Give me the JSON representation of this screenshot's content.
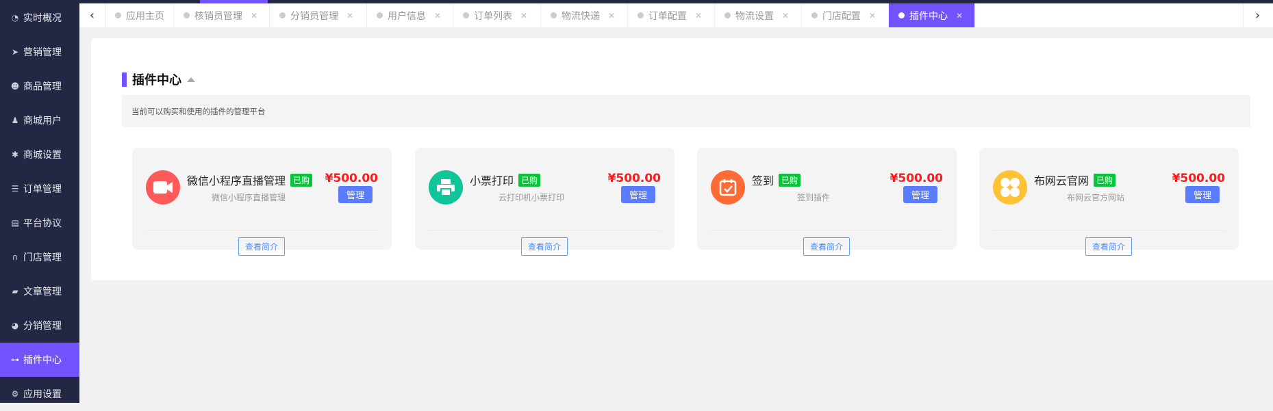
{
  "sidebar": {
    "items": [
      {
        "label": "实时概况",
        "icon": "dashboard-icon"
      },
      {
        "label": "营销管理",
        "icon": "paper-plane-icon"
      },
      {
        "label": "商品管理",
        "icon": "product-icon"
      },
      {
        "label": "商城用户",
        "icon": "user-icon"
      },
      {
        "label": "商城设置",
        "icon": "asterisk-icon"
      },
      {
        "label": "订单管理",
        "icon": "list-icon"
      },
      {
        "label": "平台协议",
        "icon": "document-icon"
      },
      {
        "label": "门店管理",
        "icon": "binoculars-icon"
      },
      {
        "label": "文章管理",
        "icon": "book-icon"
      },
      {
        "label": "分销管理",
        "icon": "pie-chart-icon"
      },
      {
        "label": "插件中心",
        "icon": "gamepad-icon",
        "active": true
      },
      {
        "label": "应用设置",
        "icon": "gear-icon"
      }
    ]
  },
  "tabs": [
    {
      "label": "应用主页",
      "closable": false
    },
    {
      "label": "核销员管理",
      "closable": true
    },
    {
      "label": "分销员管理",
      "closable": true
    },
    {
      "label": "用户信息",
      "closable": true
    },
    {
      "label": "订单列表",
      "closable": true
    },
    {
      "label": "物流快递",
      "closable": true
    },
    {
      "label": "订单配置",
      "closable": true
    },
    {
      "label": "物流设置",
      "closable": true
    },
    {
      "label": "门店配置",
      "closable": true
    },
    {
      "label": "插件中心",
      "closable": true,
      "active": true
    }
  ],
  "page": {
    "title": "插件中心",
    "description": "当前可以购买和使用的插件的管理平台"
  },
  "plugins": [
    {
      "name": "微信小程序直播管理",
      "badge": "已购",
      "subtitle": "微信小程序直播管理",
      "price": "¥500.00",
      "manage": "管理",
      "intro": "查看简介",
      "icon": "video-camera-icon",
      "color": "#ff5a5a"
    },
    {
      "name": "小票打印",
      "badge": "已购",
      "subtitle": "云打印机小票打印",
      "price": "¥500.00",
      "manage": "管理",
      "intro": "查看简介",
      "icon": "printer-icon",
      "color": "#10c59a"
    },
    {
      "name": "签到",
      "badge": "已购",
      "subtitle": "签到插件",
      "price": "¥500.00",
      "manage": "管理",
      "intro": "查看简介",
      "icon": "calendar-check-icon",
      "color": "#ff6b35"
    },
    {
      "name": "布网云官网",
      "badge": "已购",
      "subtitle": "布网云官方网站",
      "price": "¥500.00",
      "manage": "管理",
      "intro": "查看简介",
      "icon": "clover-icon",
      "color": "#ffc234"
    }
  ]
}
